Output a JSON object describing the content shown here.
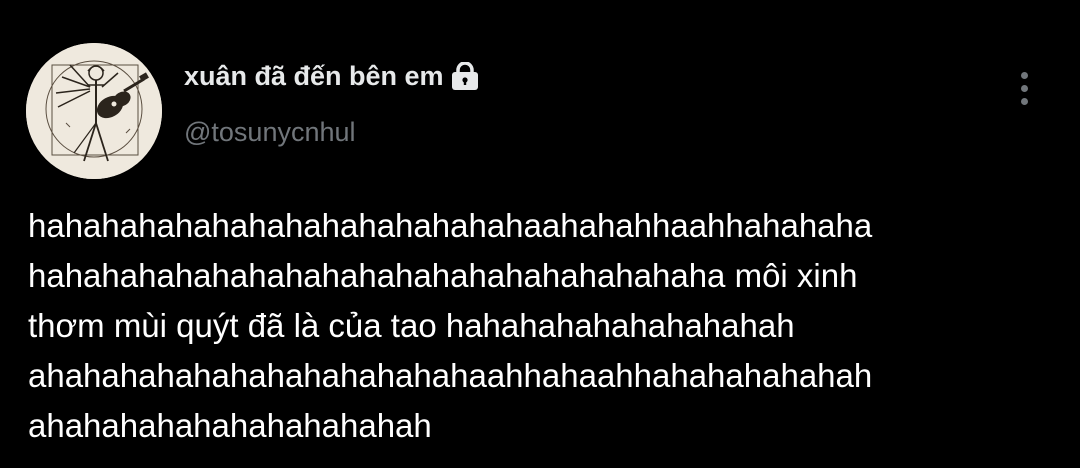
{
  "colors": {
    "background": "#000000",
    "name": "#e7e9ea",
    "handle": "#71767b",
    "text": "#ffffff"
  },
  "author": {
    "display_name": "xuân đã đến bên em",
    "handle": "@tosunycnhul",
    "avatar_icon": "vitruvian-guitar-avatar",
    "protected_icon": "lock-icon"
  },
  "more_menu_icon": "more-vertical-icon",
  "tweet": {
    "lines": [
      "hahahahahahahahahahahahahahaahahahhaahhahahaha",
      "hahahahahahahahahahahahahahahahahahaha môi xinh",
      "thơm mùi quýt đã là của tao hahahahahahahahahah",
      "ahahahahahahahahahahahahaahhahaahhahahahahahah",
      "ahahahahahahahahahahah"
    ]
  }
}
